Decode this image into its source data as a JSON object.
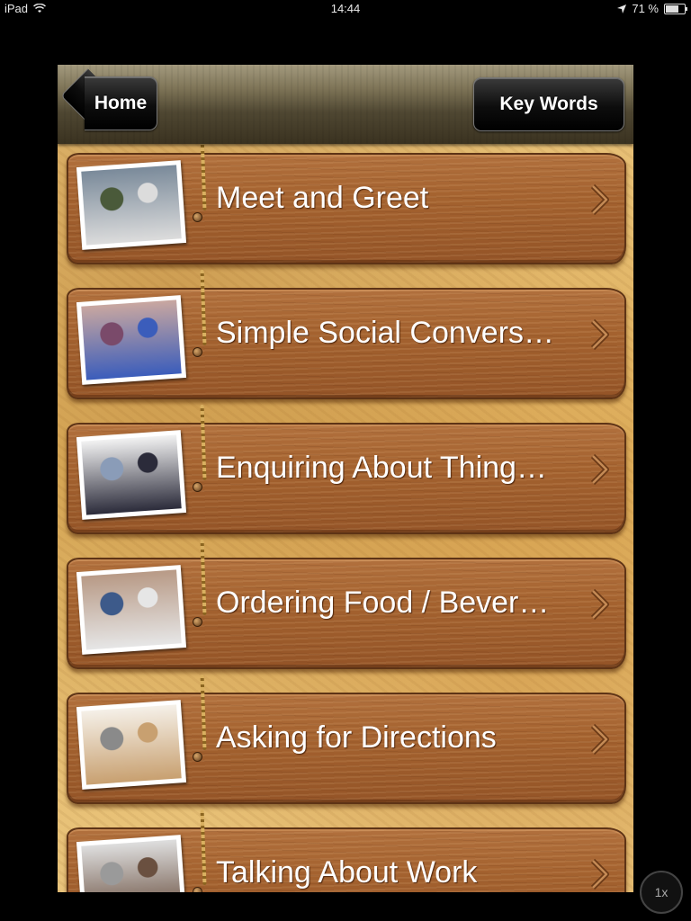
{
  "status_bar": {
    "device": "iPad",
    "time": "14:44",
    "battery_percent": "71 %",
    "battery_level": 0.71
  },
  "navbar": {
    "back_label": "Home",
    "right_label": "Key Words"
  },
  "topics": [
    {
      "label": "Meet and Greet",
      "photo_icon": "people-greeting-photo"
    },
    {
      "label": "Simple Social Convers…",
      "photo_icon": "social-conversation-photo"
    },
    {
      "label": "Enquiring About Thing…",
      "photo_icon": "enquiring-photo"
    },
    {
      "label": "Ordering Food / Bever…",
      "photo_icon": "ordering-food-photo"
    },
    {
      "label": "Asking for Directions",
      "photo_icon": "directions-photo"
    },
    {
      "label": "Talking About Work",
      "photo_icon": "work-photo"
    }
  ],
  "zoom_label": "1x",
  "colors": {
    "plank": "#a4622f",
    "background": "#e2b562",
    "navbar": "#4f4732"
  }
}
